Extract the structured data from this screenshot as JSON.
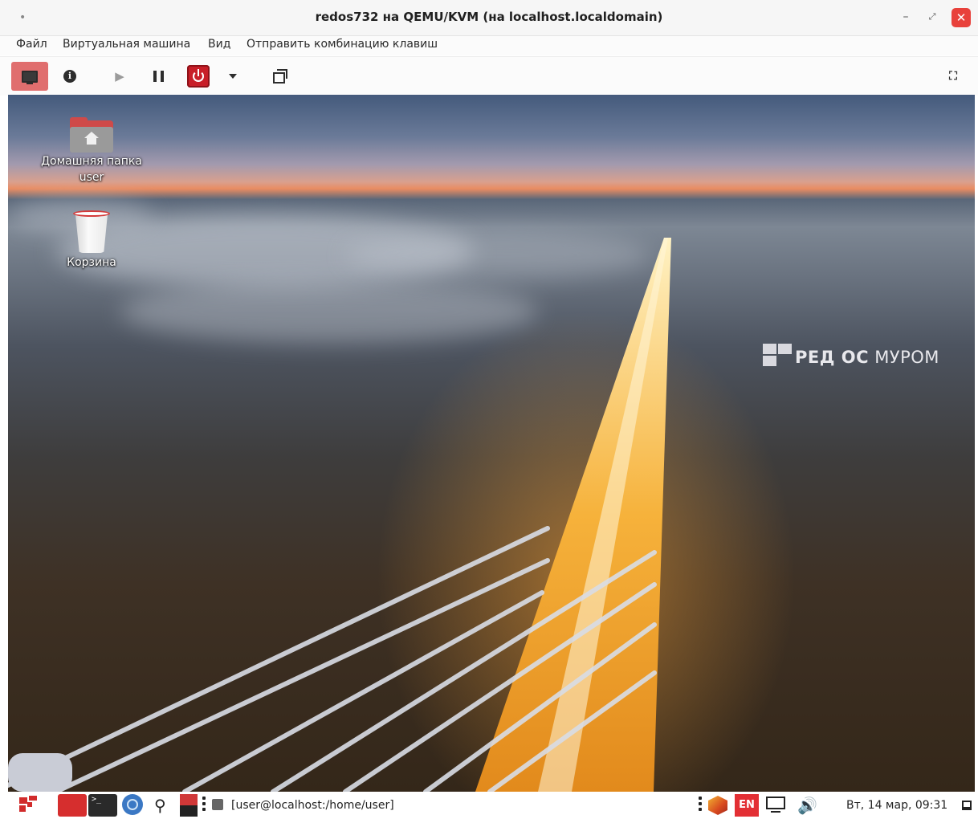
{
  "window": {
    "title": "redos732 на QEMU/KVM (на localhost.localdomain)",
    "menu_glyph": "•",
    "minimize_glyph": "–",
    "maximize_glyph": "⤢",
    "close_glyph": "✕",
    "close_color": "#e8413b"
  },
  "menubar": {
    "items": [
      "Файл",
      "Виртуальная машина",
      "Вид",
      "Отправить комбинацию клавиш"
    ]
  },
  "toolbar": {
    "info_glyph": "i",
    "play_glyph": "▶",
    "fullscreen_glyph": "⛶",
    "console_active_color": "#e06e6e",
    "power_color": "#c81e28"
  },
  "desktop": {
    "icons": [
      {
        "label_line1": "Домашняя папка",
        "label_line2": "user"
      },
      {
        "label_line1": "Корзина"
      }
    ],
    "brand": {
      "part1": "РЕД ОС",
      "part2": " МУРОМ"
    }
  },
  "taskbar": {
    "terminal_glyph": ">_",
    "search_glyph": "⚲",
    "task_label": "[user@localhost:/home/user]",
    "lang": "EN",
    "volume_glyph": "🔊",
    "clock": "Вт, 14 мар, 09:31",
    "accent": "#d12b2b"
  }
}
